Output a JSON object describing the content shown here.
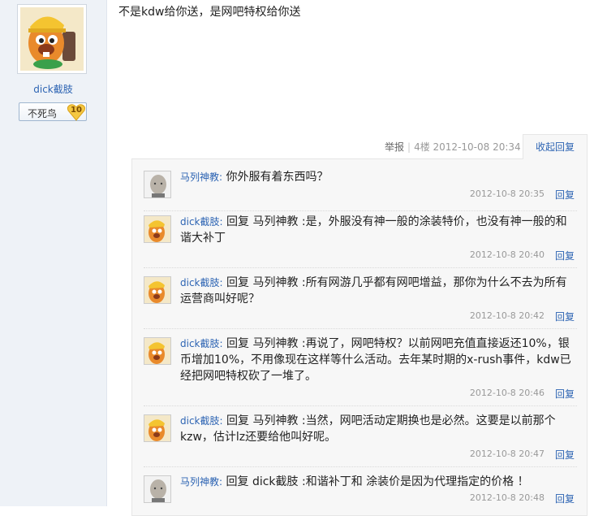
{
  "author": {
    "username": "dick截肢",
    "rank_title": "不死鸟",
    "rank_level": "10"
  },
  "post": {
    "content": "不是kdw给你送，是网吧特权给你送",
    "report_label": "举报",
    "separator": "|",
    "floor": "4楼",
    "timestamp": "2012-10-08 20:34",
    "collapse_label": "收起回复"
  },
  "replies": [
    {
      "user": "马列神教:",
      "text": "你外服有着东西吗？",
      "time": "2012-10-8 20:35",
      "reply_label": "回复",
      "avatar": "bald-man"
    },
    {
      "user": "dick截肢:",
      "text": "回复 马列神教 :是，外服没有神一般的涂装特价，也没有神一般的和谐大补丁",
      "time": "2012-10-8 20:40",
      "reply_label": "回复",
      "avatar": "cartoon-beaver"
    },
    {
      "user": "dick截肢:",
      "text": "回复 马列神教 :所有网游几乎都有网吧增益，那你为什么不去为所有运营商叫好呢？",
      "time": "2012-10-8 20:42",
      "reply_label": "回复",
      "avatar": "cartoon-beaver"
    },
    {
      "user": "dick截肢:",
      "text": "回复 马列神教 :再说了，网吧特权？以前网吧充值直接返还10%，银币增加10%，不用像现在这样等什么活动。去年某时期的x-rush事件，kdw已经把网吧特权砍了一堆了。",
      "time": "2012-10-8 20:46",
      "reply_label": "回复",
      "avatar": "cartoon-beaver"
    },
    {
      "user": "dick截肢:",
      "text": "回复 马列神教 :当然，网吧活动定期换也是必然。这要是以前那个kzw，估计lz还要给他叫好呢。",
      "time": "2012-10-8 20:47",
      "reply_label": "回复",
      "avatar": "cartoon-beaver"
    },
    {
      "user": "马列神教:",
      "text": "回复 dick截肢 :和谐补丁和 涂装价是因为代理指定的价格 ！",
      "time": "2012-10-8 20:48",
      "reply_label": "回复",
      "avatar": "bald-man"
    }
  ],
  "colors": {
    "link": "#2d64b3",
    "sidebar_bg": "#eef2f7",
    "reply_bg": "#f7f7f7",
    "meta_text": "#999999"
  }
}
